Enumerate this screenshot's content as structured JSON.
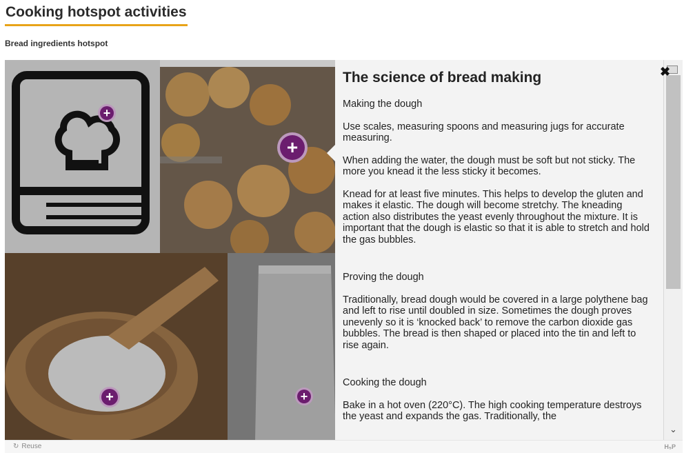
{
  "page": {
    "title": "Cooking hotspot activities",
    "subtitle": "Bread ingredients hotspot"
  },
  "popup": {
    "title": "The science of bread making",
    "paragraphs": [
      "Making the dough",
      "Use scales, measuring spoons and measuring jugs for accurate measuring.",
      "When adding the water, the dough must be soft but not sticky.  The more you knead it the less sticky it becomes.",
      "Knead for at least five minutes. This helps to develop the gluten and makes it elastic.  The dough will become stretchy.  The kneading action also distributes the yeast evenly throughout the mixture.  It is important that the dough is elastic so that it is able to stretch and hold the gas bubbles.",
      "Proving the dough",
      "Traditionally, bread dough would be covered in a large polythene bag and left to rise until doubled in size.  Sometimes the dough proves unevenly so it is ‘knocked back’ to remove the carbon dioxide gas bubbles.  The bread is then shaped or placed into the tin and left to rise again.",
      "Cooking the dough",
      "Bake in a hot oven (220°C).  The high cooking temperature destroys the yeast and expands the gas.  Traditionally, the"
    ]
  },
  "hotspots": {
    "symbol": "+"
  },
  "controls": {
    "close_symbol": "✖",
    "scroll_down_symbol": "⌄"
  },
  "footer": {
    "reuse_label": "Reuse",
    "reuse_icon": "↻",
    "logo": "H₅P"
  },
  "colors": {
    "accent": "#e8a318",
    "hotspot": "#6b1d6e"
  }
}
